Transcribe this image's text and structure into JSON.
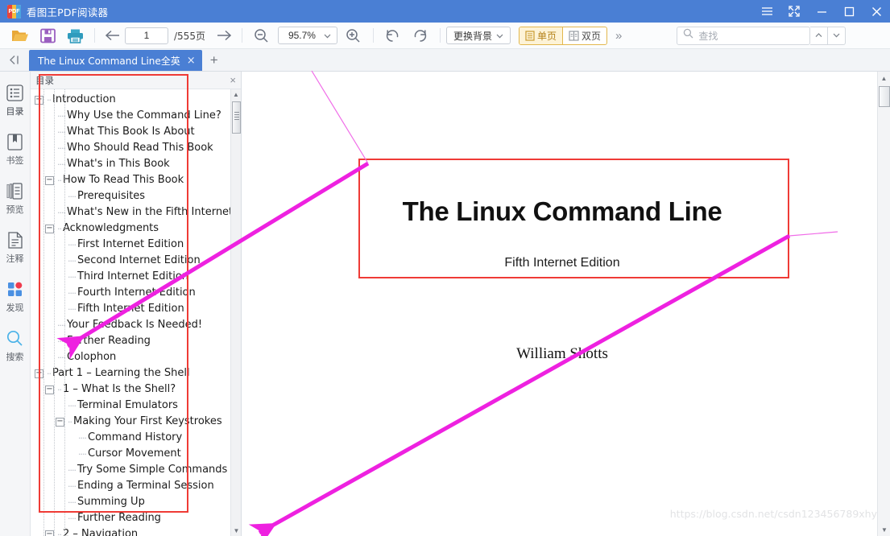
{
  "window": {
    "app_title": "看图王PDF阅读器",
    "logo_text": "PDF",
    "controls": {
      "menu": "menu-hamburger",
      "fullscreen": "fullscreen",
      "minimize": "minimize",
      "maximize": "maximize",
      "close": "close"
    }
  },
  "toolbar": {
    "open_label": "open-file",
    "save_label": "save",
    "print_label": "print",
    "prev_page": "previous-page",
    "next_page": "next-page",
    "page_number": "1",
    "page_total": "/555页",
    "zoom_out": "zoom-out",
    "zoom_in": "zoom-in",
    "zoom_value": "95.7%",
    "rotate_left": "rotate-left",
    "rotate_right": "rotate-right",
    "background_label": "更换背景",
    "single_page_label": "单页",
    "double_page_label": "双页",
    "more_label": "»",
    "search_placeholder": "查找",
    "search_value": "",
    "search_prev": "search-previous",
    "search_next": "search-next"
  },
  "tabs": {
    "back_label": "◁|",
    "items": [
      {
        "label": "The Linux Command Line全英",
        "active": true,
        "close": "×"
      }
    ],
    "add_label": "+"
  },
  "rail": {
    "items": [
      {
        "label": "目录",
        "icon": "list-icon",
        "active": true
      },
      {
        "label": "书签",
        "icon": "bookmark-icon",
        "active": false
      },
      {
        "label": "预览",
        "icon": "preview-icon",
        "active": false
      },
      {
        "label": "注释",
        "icon": "annotation-icon",
        "active": false
      },
      {
        "label": "发现",
        "icon": "discover-icon",
        "active": false
      },
      {
        "label": "搜索",
        "icon": "search-icon",
        "active": false
      }
    ]
  },
  "toc": {
    "title": "目录",
    "close_label": "×",
    "rows": [
      {
        "label": "Introduction",
        "indent": 0,
        "twisty": "−"
      },
      {
        "label": "Why Use the Command Line?",
        "indent": 1,
        "twisty": ""
      },
      {
        "label": "What This Book Is About",
        "indent": 1,
        "twisty": ""
      },
      {
        "label": "Who Should Read This Book",
        "indent": 1,
        "twisty": ""
      },
      {
        "label": "What's in This Book",
        "indent": 1,
        "twisty": ""
      },
      {
        "label": "How To Read This Book",
        "indent": 1,
        "twisty": "−"
      },
      {
        "label": "Prerequisites",
        "indent": 2,
        "twisty": ""
      },
      {
        "label": "What's New in the Fifth Internet Ed",
        "indent": 1,
        "twisty": ""
      },
      {
        "label": "Acknowledgments",
        "indent": 1,
        "twisty": "−"
      },
      {
        "label": "First Internet Edition",
        "indent": 2,
        "twisty": ""
      },
      {
        "label": "Second Internet Edition",
        "indent": 2,
        "twisty": ""
      },
      {
        "label": "Third Internet Edition",
        "indent": 2,
        "twisty": ""
      },
      {
        "label": "Fourth Internet Edition",
        "indent": 2,
        "twisty": ""
      },
      {
        "label": "Fifth Internet Edition",
        "indent": 2,
        "twisty": ""
      },
      {
        "label": "Your Feedback Is Needed!",
        "indent": 1,
        "twisty": ""
      },
      {
        "label": "Further Reading",
        "indent": 1,
        "twisty": ""
      },
      {
        "label": "Colophon",
        "indent": 1,
        "twisty": ""
      },
      {
        "label": "Part 1 – Learning the Shell",
        "indent": 0,
        "twisty": "−"
      },
      {
        "label": "1 – What Is the Shell?",
        "indent": 1,
        "twisty": "−"
      },
      {
        "label": "Terminal Emulators",
        "indent": 2,
        "twisty": ""
      },
      {
        "label": "Making Your First Keystrokes",
        "indent": 2,
        "twisty": "−"
      },
      {
        "label": "Command History",
        "indent": 3,
        "twisty": ""
      },
      {
        "label": "Cursor Movement",
        "indent": 3,
        "twisty": ""
      },
      {
        "label": "Try Some Simple Commands",
        "indent": 2,
        "twisty": ""
      },
      {
        "label": "Ending a Terminal Session",
        "indent": 2,
        "twisty": ""
      },
      {
        "label": "Summing Up",
        "indent": 2,
        "twisty": ""
      },
      {
        "label": "Further Reading",
        "indent": 2,
        "twisty": ""
      },
      {
        "label": "2 – Navigation",
        "indent": 1,
        "twisty": "−"
      }
    ]
  },
  "document": {
    "title": "The Linux Command Line",
    "subtitle": "Fifth Internet Edition",
    "author": "William Shotts",
    "watermark": "https://blog.csdn.net/csdn123456789xhy"
  },
  "annotations": {
    "rect_color": "#ef3b36",
    "arrow_color": "#ee21e0",
    "line_color": "#f06ce8"
  }
}
